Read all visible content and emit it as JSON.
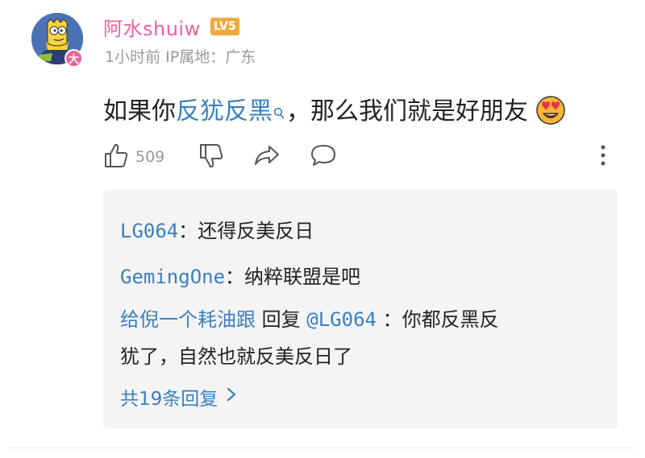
{
  "user": {
    "name": "阿水shuiw",
    "level": "LV5",
    "avatar_badge": "大",
    "meta": "1小时前 IP属地：广东"
  },
  "comment": {
    "text_before": "如果你",
    "link_text": "反犹反黑",
    "text_after": "，那么我们就是好朋友",
    "emoji": "heart-eyes-emoji"
  },
  "actions": {
    "like_count": "509",
    "icons": [
      "thumb-up-icon",
      "thumb-down-icon",
      "share-icon",
      "comment-icon",
      "more-icon"
    ]
  },
  "replies": [
    {
      "name": "LG064",
      "sep": "：",
      "text": "还得反美反日"
    },
    {
      "name": "GemingOne",
      "sep": "：",
      "text": "纳粹联盟是吧"
    },
    {
      "name": "给倪一个耗油跟",
      "action": "回复",
      "mention": "@LG064",
      "text_line1": "：你都反黑反",
      "text_line2": "犹了，自然也就反美反日了"
    }
  ],
  "more_replies": "共19条回复",
  "colors": {
    "accent_pink": "#f0609a",
    "link_blue": "#3a7fc0",
    "level_orange": "#f2a93b",
    "meta_gray": "#999999"
  }
}
